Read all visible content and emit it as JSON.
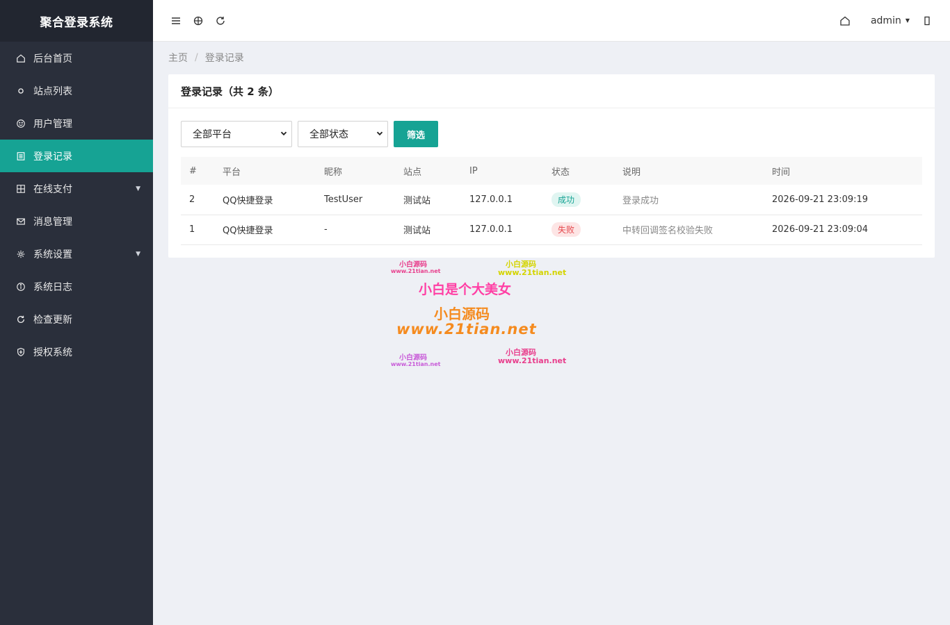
{
  "app": {
    "title": "聚合登录系统"
  },
  "sidebar": {
    "items": [
      {
        "label": "后台首页",
        "icon": "home-icon",
        "active": false,
        "has_sub": false
      },
      {
        "label": "站点列表",
        "icon": "circle-icon",
        "active": false,
        "has_sub": false
      },
      {
        "label": "用户管理",
        "icon": "smile-icon",
        "active": false,
        "has_sub": false
      },
      {
        "label": "登录记录",
        "icon": "list-icon",
        "active": true,
        "has_sub": false
      },
      {
        "label": "在线支付",
        "icon": "grid-icon",
        "active": false,
        "has_sub": true
      },
      {
        "label": "消息管理",
        "icon": "mail-icon",
        "active": false,
        "has_sub": false
      },
      {
        "label": "系统设置",
        "icon": "gear-icon",
        "active": false,
        "has_sub": true
      },
      {
        "label": "系统日志",
        "icon": "info-icon",
        "active": false,
        "has_sub": false
      },
      {
        "label": "检查更新",
        "icon": "refresh-icon",
        "active": false,
        "has_sub": false
      },
      {
        "label": "授权系统",
        "icon": "shield-icon",
        "active": false,
        "has_sub": false
      }
    ]
  },
  "header": {
    "user": "admin"
  },
  "breadcrumb": {
    "home": "主页",
    "current": "登录记录"
  },
  "card": {
    "title": "登录记录（共 2 条）"
  },
  "filters": {
    "platform": "全部平台",
    "status": "全部状态",
    "button": "筛选"
  },
  "table": {
    "columns": [
      "#",
      "平台",
      "昵称",
      "站点",
      "IP",
      "状态",
      "说明",
      "时间"
    ],
    "rows": [
      {
        "id": "2",
        "platform": "QQ快捷登录",
        "nickname": "TestUser",
        "site": "测试站",
        "ip": "127.0.0.1",
        "status": "成功",
        "status_type": "ok",
        "note": "登录成功",
        "time": "2026-09-21 23:09:19"
      },
      {
        "id": "1",
        "platform": "QQ快捷登录",
        "nickname": "-",
        "site": "测试站",
        "ip": "127.0.0.1",
        "status": "失败",
        "status_type": "fail",
        "note": "中转回调签名校验失败",
        "time": "2026-09-21 23:09:04"
      }
    ]
  },
  "watermark": {
    "lines": [
      "小白源码",
      "www.21tian.net",
      "小白源码",
      "www.21tian.net",
      "小白是个大美女",
      "小白源码",
      "www.21tian.net",
      "小白源码",
      "www.21tian.net",
      "小白源码",
      "www.21tian.net"
    ]
  },
  "colors": {
    "accent": "#16a394",
    "sidebar": "#2a2f3b",
    "brand_bg": "#222630",
    "success": "#16a394",
    "danger": "#e5484d"
  }
}
